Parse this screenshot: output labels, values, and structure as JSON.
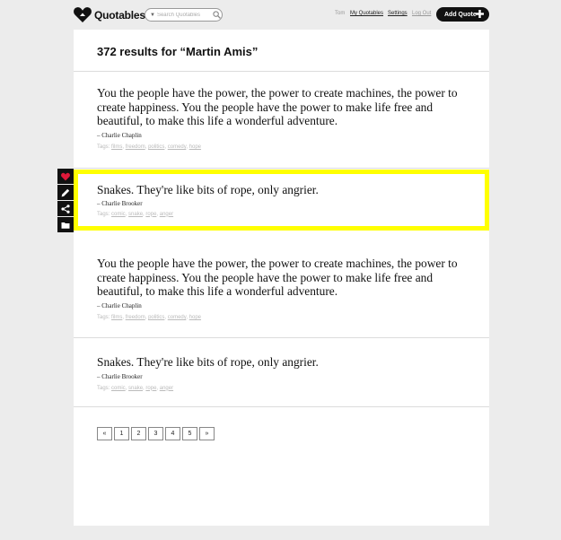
{
  "header": {
    "logo_text": "Quotables",
    "search_placeholder": "Search Quotables",
    "user_name": "Tom",
    "my_quotables": "My Quotables",
    "settings": "Settings",
    "log_out": "Log Out",
    "add_quote": "Add Quote"
  },
  "results": {
    "title": "372 results for “Martin Amis”"
  },
  "quotes": [
    {
      "text": "You the people have the power, the power to create machines, the power to create happiness. You the people have the power to make life free and beautiful, to make this life a wonderful adventure.",
      "author": "– Charlie Chaplin",
      "tags_label": "Tags:",
      "tags": [
        "films",
        "freedom",
        "politics",
        "comedy",
        "hope"
      ]
    },
    {
      "text": "Snakes. They're like bits of rope, only angrier.",
      "author": "– Charlie Brooker",
      "tags_label": "Tags:",
      "tags": [
        "comic",
        "snake",
        "rope",
        "anger"
      ]
    },
    {
      "text": "You the people have the power, the power to create machines, the power to create happiness. You the people have the power to make life free and beautiful, to make this life a wonderful adventure.",
      "author": "– Charlie Chaplin",
      "tags_label": "Tags:",
      "tags": [
        "films",
        "freedom",
        "politics",
        "comedy",
        "hope"
      ]
    },
    {
      "text": "Snakes. They're like bits of rope, only angrier.",
      "author": "– Charlie Brooker",
      "tags_label": "Tags:",
      "tags": [
        "comic",
        "snake",
        "rope",
        "anger"
      ]
    }
  ],
  "sidebar": {
    "icons": [
      "heart-icon",
      "pencil-icon",
      "share-icon",
      "folder-icon"
    ]
  },
  "pagination": {
    "prev": "«",
    "pages": [
      "1",
      "2",
      "3",
      "4",
      "5"
    ],
    "next": "»"
  },
  "colors": {
    "highlight": "#ffff00",
    "favorite": "#e0193a"
  }
}
